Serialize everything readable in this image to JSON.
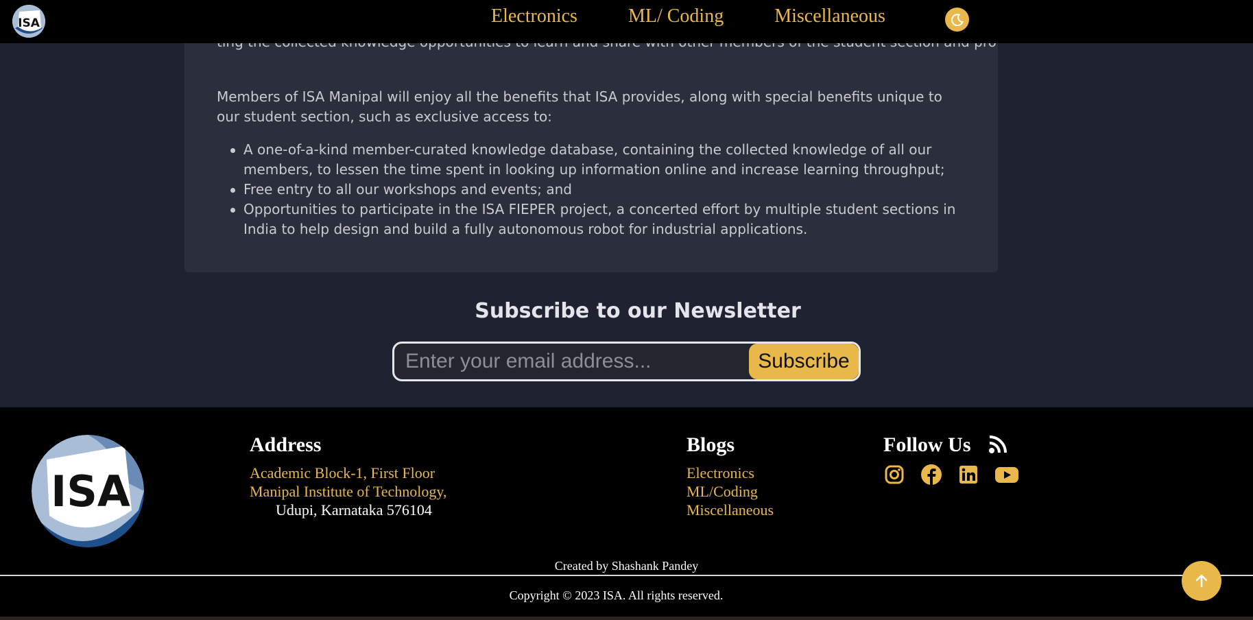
{
  "nav": {
    "logo_text": "ISA",
    "links": [
      "Electronics",
      "ML/ Coding",
      "Miscellaneous"
    ],
    "theme_icon": "moon-icon"
  },
  "card": {
    "partial_line": "ting the collected knowledge opportunities to learn and share with other members of the student section and professionals",
    "intro": "Members of ISA Manipal will enjoy all the benefits that ISA provides, along with special benefits unique to our student section, such as exclusive access to:",
    "benefits": [
      "A one-of-a-kind member-curated knowledge database, containing the collected knowledge of all our members, to lessen the time spent in looking up information online and increase learning throughput;",
      "Free entry to all our workshops and events; and",
      "Opportunities to participate in the ISA FIEPER project, a concerted effort by multiple student sections in India to help design and build a fully autonomous robot for industrial applications."
    ]
  },
  "newsletter": {
    "title": "Subscribe to our Newsletter",
    "placeholder": "Enter your email address...",
    "button": "Subscribe"
  },
  "footer": {
    "logo_text": "ISA",
    "address_title": "Address",
    "address_lines": [
      "Academic Block-1, First Floor",
      "Manipal Institute of Technology,",
      "Udupi, Karnataka 576104"
    ],
    "blogs_title": "Blogs",
    "blogs": [
      "Electronics",
      "ML/Coding",
      "Miscellaneous"
    ],
    "follow_title": "Follow Us",
    "social_icons": [
      "instagram-icon",
      "facebook-icon",
      "linkedin-icon",
      "youtube-icon"
    ],
    "credit": "Created by Shashank Pandey",
    "copyright": "Copyright © 2023 ISA. All rights reserved."
  },
  "colors": {
    "accent": "#e8b84a",
    "page_bg": "#1f2231",
    "card_bg": "#2b2f3b",
    "footer_bg": "#000000"
  }
}
